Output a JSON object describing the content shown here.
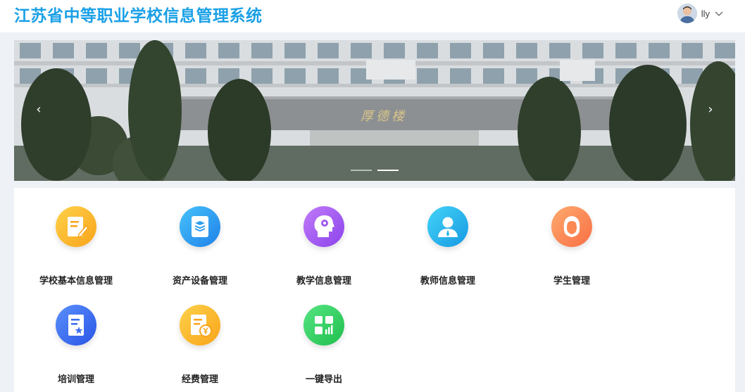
{
  "header": {
    "title": "江苏省中等职业学校信息管理系统",
    "user": {
      "name": "lly",
      "avatar_icon": "user-avatar",
      "dropdown_icon": "chevron-down-icon"
    }
  },
  "banner": {
    "building_sign": "厚德楼",
    "prev_icon": "chevron-left-icon",
    "next_icon": "chevron-right-icon",
    "prev_glyph": "‹",
    "next_glyph": "›",
    "slides": 2,
    "active_slide": 2
  },
  "modules": [
    {
      "label": "学校基本信息管理",
      "icon": "edit-document-icon",
      "color": "#fbb728"
    },
    {
      "label": "资产设备管理",
      "icon": "layers-icon",
      "color": "#2d9ef0"
    },
    {
      "label": "教学信息管理",
      "icon": "head-gear-icon",
      "color": "#a05cf0"
    },
    {
      "label": "教师信息管理",
      "icon": "teacher-icon",
      "color": "#22b3ec"
    },
    {
      "label": "学生管理",
      "icon": "student-icon",
      "color": "#fb8a55"
    },
    {
      "label": "培训管理",
      "icon": "certificate-icon",
      "color": "#3a6df0"
    },
    {
      "label": "经费管理",
      "icon": "finance-document-icon",
      "color": "#fbb728"
    },
    {
      "label": "一键导出",
      "icon": "export-grid-icon",
      "color": "#2fd160"
    }
  ]
}
